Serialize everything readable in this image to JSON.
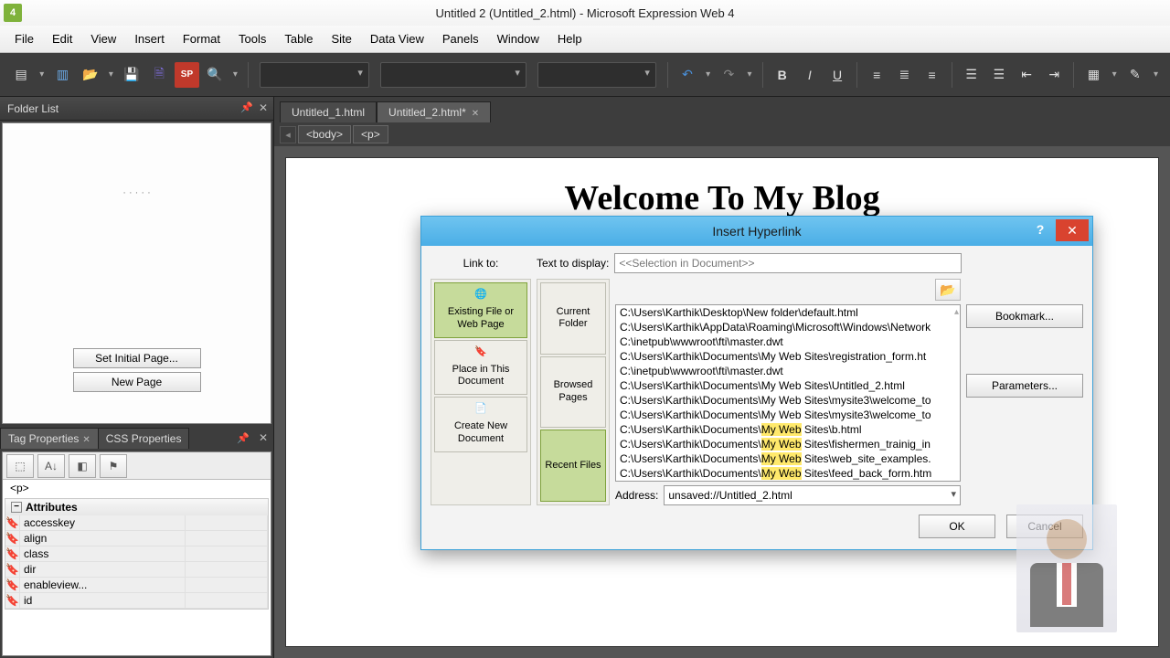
{
  "title": "Untitled 2 (Untitled_2.html) - Microsoft Expression Web 4",
  "app_badge": "4",
  "menus": [
    "File",
    "Edit",
    "View",
    "Insert",
    "Format",
    "Tools",
    "Table",
    "Site",
    "Data View",
    "Panels",
    "Window",
    "Help"
  ],
  "panels": {
    "folder_list": {
      "title": "Folder List",
      "set_initial": "Set Initial Page...",
      "new_page": "New Page"
    },
    "tag_props": {
      "tabs": [
        "Tag Properties",
        "CSS Properties"
      ],
      "current": "<p>",
      "section": "Attributes",
      "attrs": [
        "accesskey",
        "align",
        "class",
        "dir",
        "enableview...",
        "id"
      ]
    }
  },
  "doc_tabs": [
    "Untitled_1.html",
    "Untitled_2.html*"
  ],
  "breadcrumb": [
    "<body>",
    "<p>"
  ],
  "page_heading": "Welcome To My Blog",
  "dialog": {
    "title": "Insert Hyperlink",
    "link_to": "Link to:",
    "text_to_display_label": "Text to display:",
    "text_to_display_value": "<<Selection in Document>>",
    "linkto_options": [
      "Existing File or Web Page",
      "Place in This Document",
      "Create New Document"
    ],
    "sub_options": [
      "Current Folder",
      "Browsed Pages",
      "Recent Files"
    ],
    "files": [
      "C:\\Users\\Karthik\\Desktop\\New folder\\default.html",
      "C:\\Users\\Karthik\\AppData\\Roaming\\Microsoft\\Windows\\Network",
      "C:\\inetpub\\wwwroot\\fti\\master.dwt",
      "C:\\Users\\Karthik\\Documents\\My Web Sites\\registration_form.ht",
      "C:\\inetpub\\wwwroot\\fti\\master.dwt",
      "C:\\Users\\Karthik\\Documents\\My Web Sites\\Untitled_2.html",
      "C:\\Users\\Karthik\\Documents\\My Web Sites\\mysite3\\welcome_to",
      "C:\\Users\\Karthik\\Documents\\My Web Sites\\mysite3\\welcome_to",
      "C:\\Users\\Karthik\\Documents\\My Web Sites\\b.html",
      "C:\\Users\\Karthik\\Documents\\My Web Sites\\fishermen_trainig_in",
      "C:\\Users\\Karthik\\Documents\\My Web Sites\\web_site_examples.",
      "C:\\Users\\Karthik\\Documents\\My Web Sites\\feed_back_form.htm"
    ],
    "address_label": "Address:",
    "address_value": "unsaved://Untitled_2.html",
    "bookmark": "Bookmark...",
    "parameters": "Parameters...",
    "ok": "OK",
    "cancel": "Cancel"
  }
}
